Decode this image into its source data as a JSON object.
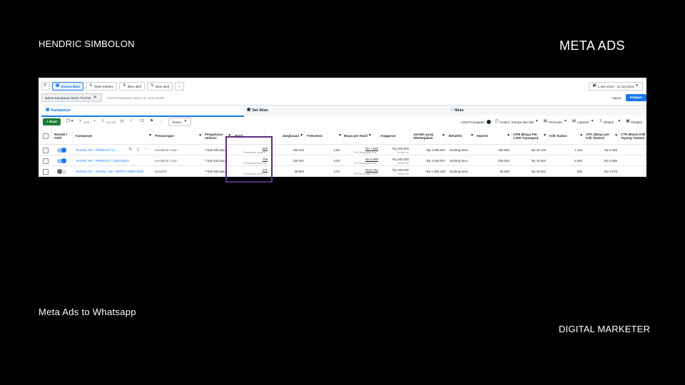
{
  "slide": {
    "author": "HENDRIC SIMBOLON",
    "brand": "META ADS",
    "subtitle": "Meta Ads to Whatsapp",
    "role": "DIGITAL MARKETER",
    "highlight_color": "#5b2d82"
  },
  "filters": {
    "chips": [
      {
        "label": "Semua Iklan",
        "icon": "folder-icon",
        "active": true
      },
      {
        "label": "Telah terkirim",
        "icon": "lightning-icon",
        "active": false
      },
      {
        "label": "Iklan aktif",
        "icon": "lightning-icon",
        "active": false
      },
      {
        "label": "Iklan aktif",
        "icon": "lightning-icon",
        "active": false
      }
    ],
    "add_label": "+",
    "date_range": "1 Mei 2024 - 31 Jul 2024",
    "active_filter": "Nama Kampanye berisi TAJAM",
    "search_placeholder": "Cari berdasarkan nama, ID, atau metrik",
    "clear_label": "Hapus",
    "save_label": "Simpan"
  },
  "tabs": [
    {
      "label": "Kampanye",
      "active": true
    },
    {
      "label": "Set Iklan",
      "active": false
    },
    {
      "label": "Iklan",
      "active": false
    }
  ],
  "toolbar": {
    "create_label": "+ Buat",
    "edit_label": "Edit",
    "ab_label": "Uji A/B",
    "rules_label": "Aturan",
    "view_setup_label": "Lihat Penyiapan",
    "columns_label": "Kolom: Kinerja dan klik",
    "breakdown_label": "Perincian",
    "reports_label": "Laporan",
    "export_label": "Ekspor",
    "summary_label": "Ringkat"
  },
  "table": {
    "headers": {
      "onoff": "Nonakt / Aktif",
      "campaign": "Kampanye",
      "delivery": "Penayangan ↑",
      "attribution": "Pengaturan atribusi",
      "results": "Hasil",
      "reach": "Jangkauan",
      "frequency": "Frekuensi",
      "cost_per_result": "Biaya per Hasil",
      "budget": "Anggaran",
      "amount_spent": "Jumlah yang dibelanjakan",
      "ends": "Berakhir",
      "impressions": "Impresi",
      "cpm": "CPM (Biaya Per 1.000 Tayangan)",
      "link_clicks": "Klik Tautan",
      "cpc": "CPC (Biaya per Klik Tautan)",
      "ctr": "CTR (Rasio Klik Tayang Tautan)"
    },
    "rows": [
      {
        "active": true,
        "campaign": "TAJAM | NV - PRODUCT 2 | ...",
        "delivery": "Kesalahan Akun",
        "attribution": "7-hari klik atau...",
        "results": "549",
        "results_sub": "Percakapan pesan d...",
        "reach": "105.033",
        "frequency": "1,85",
        "cost_per_result": "Rp 7.625",
        "cost_sub": "Per Percakapan Pes...",
        "budget": "Rp 200.000",
        "budget_sub": "Setiap hari",
        "amount_spent": "Rp 4.295.634",
        "ends": "Sedang bera...",
        "impressions": "193.953",
        "cpm": "Rp 22.149",
        "link_clicks": "1.318",
        "cpc": "Rp 3.259"
      },
      {
        "active": true,
        "campaign": "TAJAM | NV - PRODUCT | 10/07/2024",
        "delivery": "Kesalahan Akun",
        "attribution": "7-hari klik atau...",
        "results": "709",
        "results_sub": "Percakapan pesan d...",
        "reach": "100.207",
        "frequency": "2,05",
        "cost_per_result": "Rp 6.065",
        "cost_sub": "Per Percakapan Pes...",
        "budget": "Rp 200.000",
        "budget_sub": "Setiap hari",
        "amount_spent": "Rp 4.300.007",
        "ends": "Sedang bera...",
        "impressions": "205.543",
        "cpm": "Rp 20.920",
        "link_clicks": "2.062",
        "cpc": "Rp 2.085"
      },
      {
        "active": false,
        "campaign": "TAJAM | NV - LEADS - WA - MITRA | 08/07/2024",
        "delivery": "Nonaktif",
        "attribution": "7-hari klik atau...",
        "results": "171",
        "results_sub": "Percakapan pesan d...",
        "reach": "39.650",
        "frequency": "2,03",
        "cost_per_result": "Rp 8.751",
        "cost_sub": "Per Percakapan Pes...",
        "budget": "Rp 100.000",
        "budget_sub": "Setiap hari",
        "amount_spent": "Rp 1.496.405",
        "ends": "Sedang bera...",
        "impressions": "80.555",
        "cpm": "Rp 18.622",
        "link_clicks": "505",
        "cpc": "Rp 2.975"
      }
    ]
  }
}
